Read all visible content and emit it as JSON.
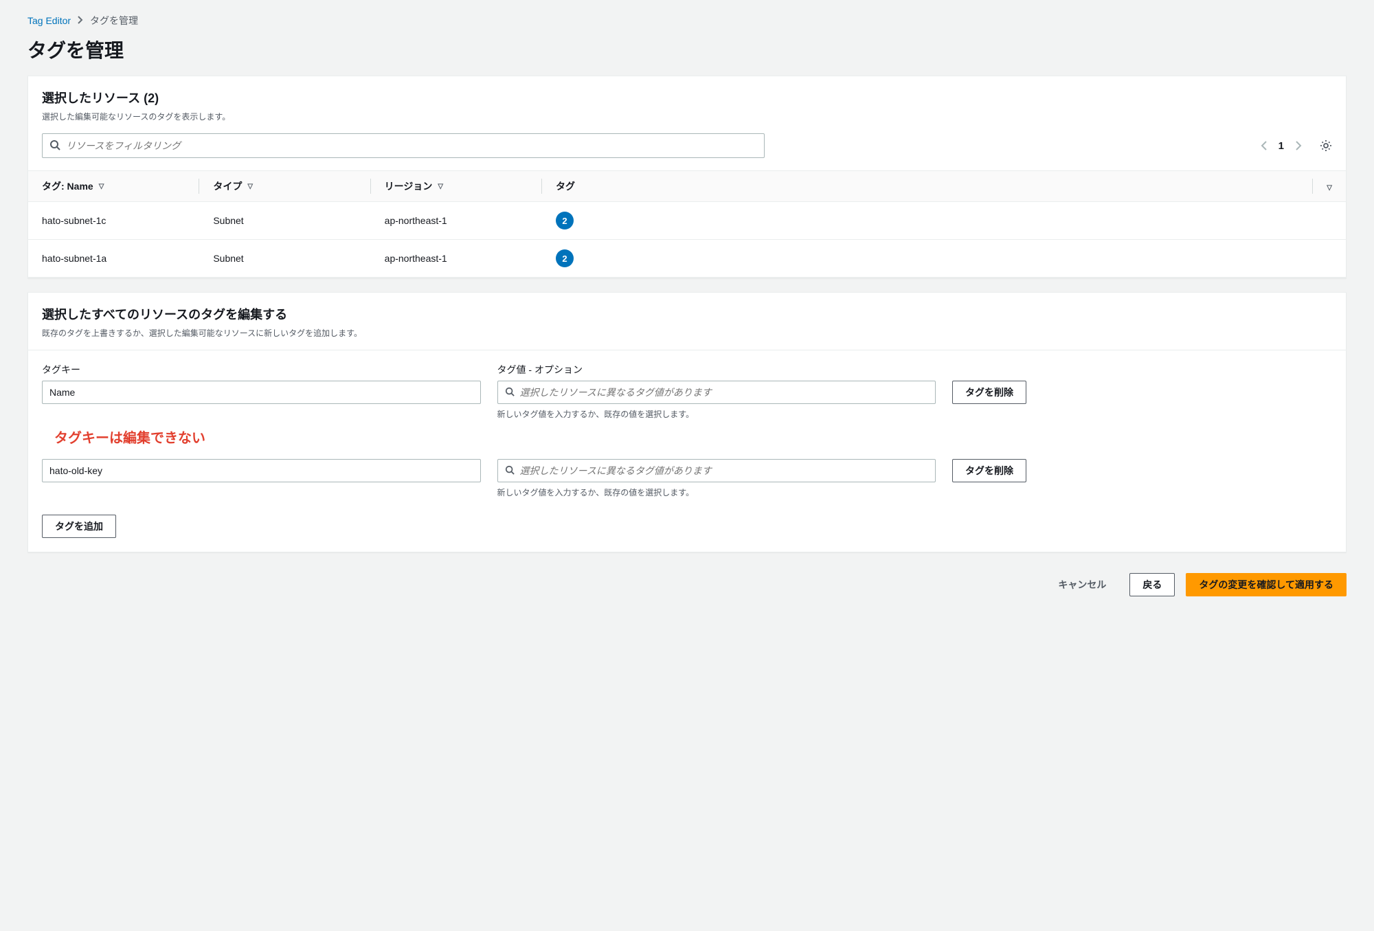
{
  "breadcrumb": {
    "root": "Tag Editor",
    "current": "タグを管理"
  },
  "page_title": "タグを管理",
  "resources_panel": {
    "title": "選択したリソース (2)",
    "description": "選択した編集可能なリソースのタグを表示します。",
    "search_placeholder": "リソースをフィルタリング",
    "page_number": "1",
    "columns": {
      "tag_name": "タグ: Name",
      "type": "タイプ",
      "region": "リージョン",
      "tags": "タグ"
    },
    "rows": [
      {
        "name": "hato-subnet-1c",
        "type": "Subnet",
        "region": "ap-northeast-1",
        "tag_count": "2"
      },
      {
        "name": "hato-subnet-1a",
        "type": "Subnet",
        "region": "ap-northeast-1",
        "tag_count": "2"
      }
    ]
  },
  "edit_panel": {
    "title": "選択したすべてのリソースのタグを編集する",
    "description": "既存のタグを上書きするか、選択した編集可能なリソースに新しいタグを追加します。",
    "key_label": "タグキー",
    "value_label": "タグ値 - オプション",
    "value_placeholder": "選択したリソースに異なるタグ値があります",
    "value_hint": "新しいタグ値を入力するか、既存の値を選択します。",
    "delete_label": "タグを削除",
    "annotation": "タグキーは編集できない",
    "rows": [
      {
        "key": "Name"
      },
      {
        "key": "hato-old-key"
      }
    ],
    "add_label": "タグを追加"
  },
  "footer": {
    "cancel": "キャンセル",
    "back": "戻る",
    "apply": "タグの変更を確認して適用する"
  }
}
